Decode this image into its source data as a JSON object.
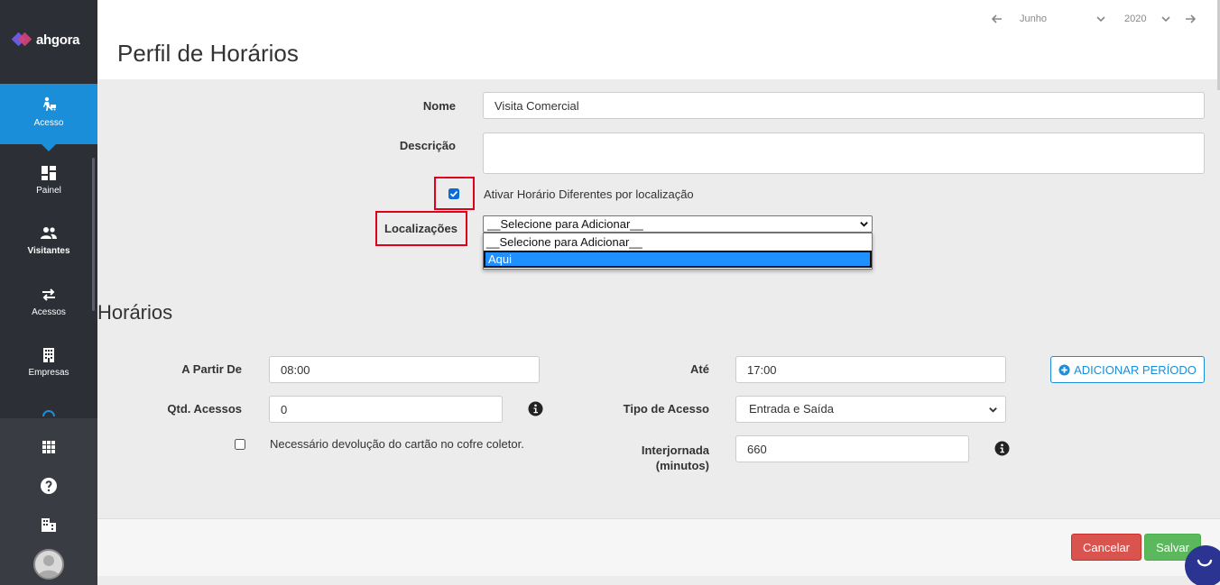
{
  "brand": {
    "name": "ahgora"
  },
  "sidebar": {
    "items": [
      {
        "label": "Acesso",
        "icon": "person-access-icon",
        "active": true
      },
      {
        "label": "Painel",
        "icon": "dashboard-icon"
      },
      {
        "label": "Visitantes",
        "icon": "visitors-icon"
      },
      {
        "label": "Acessos",
        "icon": "swap-arrows-icon"
      },
      {
        "label": "Empresas",
        "icon": "building-icon"
      }
    ],
    "lower_icons": [
      "apps-grid-icon",
      "help-icon",
      "company-icon"
    ]
  },
  "header": {
    "title": "Perfil de Horários",
    "period": {
      "month": "Junho",
      "year": "2020"
    }
  },
  "form": {
    "nome_label": "Nome",
    "nome_value": "Visita Comercial",
    "descricao_label": "Descrição",
    "descricao_value": "",
    "ativar_label": "Ativar Horário Diferentes por localização",
    "ativar_checked": true,
    "localizacoes_label": "Localizações",
    "localizacoes_selected": "__Selecione para Adicionar__",
    "localizacoes_options": [
      "__Selecione para Adicionar__",
      "Aqui"
    ],
    "localizacoes_highlighted": "Aqui"
  },
  "horarios": {
    "title": "Horários",
    "a_partir_label": "A Partir De",
    "a_partir_value": "08:00",
    "ate_label": "Até",
    "ate_value": "17:00",
    "add_period_label": "ADICIONAR PERÍODO",
    "qtd_label": "Qtd. Acessos",
    "qtd_value": "0",
    "tipo_label": "Tipo de Acesso",
    "tipo_value": "Entrada e Saída",
    "devolucao_label": "Necessário devolução do cartão no cofre coletor.",
    "devolucao_checked": false,
    "interjornada_label_1": "Interjornada",
    "interjornada_label_2": "(minutos)",
    "interjornada_value": "660"
  },
  "footer": {
    "cancel_label": "Cancelar",
    "save_label": "Salvar"
  },
  "colors": {
    "sidebar": "#2d2f36",
    "accent": "#1a8ed8",
    "danger": "#d9534f",
    "success": "#5cb85c",
    "highlight": "#e1001a"
  }
}
